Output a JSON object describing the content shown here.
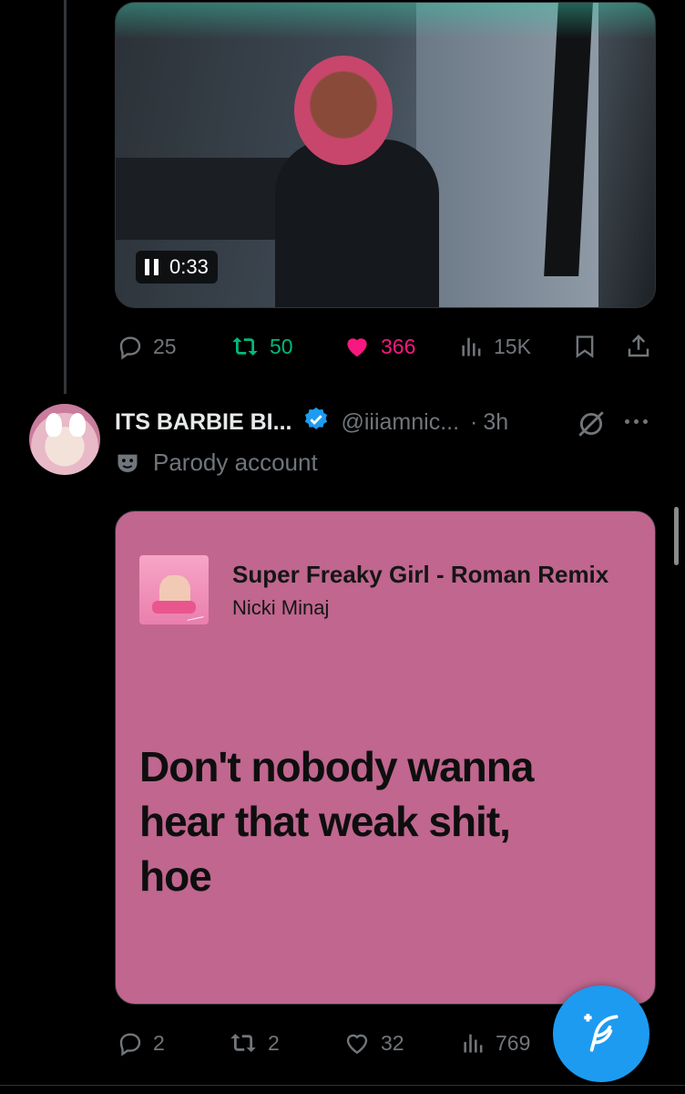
{
  "post1": {
    "video": {
      "timestamp": "0:33",
      "state_icon": "pause-icon"
    },
    "actions": {
      "replies": "25",
      "reposts": "50",
      "likes": "366",
      "views": "15K"
    },
    "colors": {
      "repost": "#00ba7c",
      "like": "#f91880",
      "muted": "#71767b"
    }
  },
  "post2": {
    "author": {
      "display_name": "ITS BARBIE BI...",
      "handle": "@iiiamnic...",
      "separator": "·",
      "time": "3h",
      "label": "Parody account",
      "verified_color": "#1d9bf0"
    },
    "lyric_card": {
      "song_title": "Super Freaky Girl - Roman Remix",
      "artist": "Nicki Minaj",
      "lyric_line1": "Don't nobody wanna",
      "lyric_line2": "hear that weak shit,",
      "lyric_line3": "hoe",
      "background": "#c0668f"
    },
    "actions": {
      "replies": "2",
      "reposts": "2",
      "likes": "32",
      "views": "769"
    }
  },
  "compose_button": {
    "icon": "compose-post-icon",
    "color": "#1d9bf0"
  }
}
